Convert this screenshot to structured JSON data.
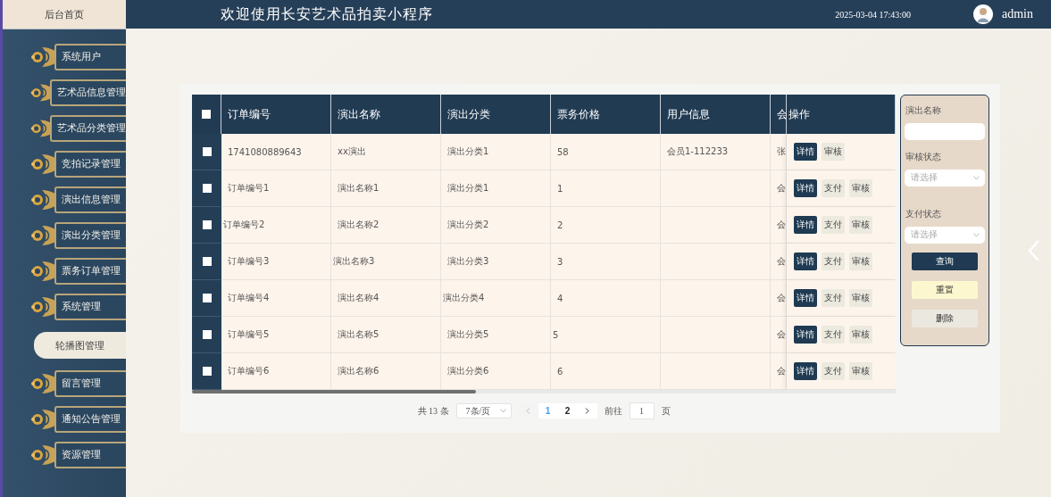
{
  "header": {
    "home": "后台首页",
    "title": "欢迎使用长安艺术品拍卖小程序",
    "datetime": "2025-03-04 17:43:00",
    "user": "admin"
  },
  "sidebar": {
    "items": [
      {
        "label": "系统用户",
        "selected": false
      },
      {
        "label": "艺术品信息管理",
        "selected": false
      },
      {
        "label": "艺术品分类管理",
        "selected": false
      },
      {
        "label": "竞拍记录管理",
        "selected": false
      },
      {
        "label": "演出信息管理",
        "selected": false
      },
      {
        "label": "演出分类管理",
        "selected": false
      },
      {
        "label": "票务订单管理",
        "selected": false
      },
      {
        "label": "系统管理",
        "selected": false
      },
      {
        "label": "轮播图管理",
        "selected": true
      },
      {
        "label": "留言管理",
        "selected": false
      },
      {
        "label": "通知公告管理",
        "selected": false
      },
      {
        "label": "资源管理",
        "selected": false
      }
    ]
  },
  "table": {
    "header_checked": false,
    "columns": [
      "订单编号",
      "演出名称",
      "演出分类",
      "票务价格",
      "用户信息",
      "会",
      "操作"
    ],
    "rows": [
      {
        "checked": false,
        "cells": [
          "1741080889643",
          "xx演出",
          "演出分类1",
          "58",
          "会员1-112233",
          "张"
        ],
        "actions": [
          {
            "label": "详情",
            "kind": "primary"
          },
          {
            "label": "审核",
            "kind": "plain"
          }
        ]
      },
      {
        "checked": false,
        "cells": [
          "订单编号1",
          "演出名称1",
          "演出分类1",
          "1",
          "",
          "会"
        ],
        "actions": [
          {
            "label": "详情",
            "kind": "primary"
          },
          {
            "label": "支付",
            "kind": "plain"
          },
          {
            "label": "审核",
            "kind": "plain"
          }
        ]
      },
      {
        "checked": false,
        "cells": [
          "订单编号2",
          "演出名称2",
          "演出分类2",
          "2",
          "",
          "会"
        ],
        "actions": [
          {
            "label": "详情",
            "kind": "primary"
          },
          {
            "label": "支付",
            "kind": "plain"
          },
          {
            "label": "审核",
            "kind": "plain"
          }
        ]
      },
      {
        "checked": false,
        "cells": [
          "订单编号3",
          "演出名称3",
          "演出分类3",
          "3",
          "",
          "会"
        ],
        "actions": [
          {
            "label": "详情",
            "kind": "primary"
          },
          {
            "label": "支付",
            "kind": "plain"
          },
          {
            "label": "审核",
            "kind": "plain"
          }
        ]
      },
      {
        "checked": false,
        "cells": [
          "订单编号4",
          "演出名称4",
          "演出分类4",
          "4",
          "",
          "会"
        ],
        "actions": [
          {
            "label": "详情",
            "kind": "primary"
          },
          {
            "label": "支付",
            "kind": "plain"
          },
          {
            "label": "审核",
            "kind": "plain"
          }
        ]
      },
      {
        "checked": false,
        "cells": [
          "订单编号5",
          "演出名称5",
          "演出分类5",
          "5",
          "",
          "会"
        ],
        "actions": [
          {
            "label": "详情",
            "kind": "primary"
          },
          {
            "label": "支付",
            "kind": "plain"
          },
          {
            "label": "审核",
            "kind": "plain"
          }
        ]
      },
      {
        "checked": false,
        "cells": [
          "订单编号6",
          "演出名称6",
          "演出分类6",
          "6",
          "",
          "会"
        ],
        "actions": [
          {
            "label": "详情",
            "kind": "primary"
          },
          {
            "label": "支付",
            "kind": "plain"
          },
          {
            "label": "审核",
            "kind": "plain"
          }
        ]
      }
    ]
  },
  "filters": [
    {
      "label": "演出名称",
      "kind": "text"
    },
    {
      "label": "审核状态",
      "kind": "select",
      "placeholder": "请选择"
    },
    {
      "label": "支付状态",
      "kind": "select",
      "placeholder": "请选择"
    }
  ],
  "filter_buttons": [
    {
      "label": "查询",
      "kind": "primary"
    },
    {
      "label": "重置",
      "kind": "warning"
    },
    {
      "label": "删除",
      "kind": "neutral"
    }
  ],
  "pagination": {
    "total": "共 13 条",
    "page_size": "7条/页",
    "pages": [
      {
        "label": "1",
        "selected": true
      },
      {
        "label": "2",
        "selected": false
      }
    ],
    "goto_label": "前往",
    "goto_value": "1",
    "page_suffix": "页"
  }
}
